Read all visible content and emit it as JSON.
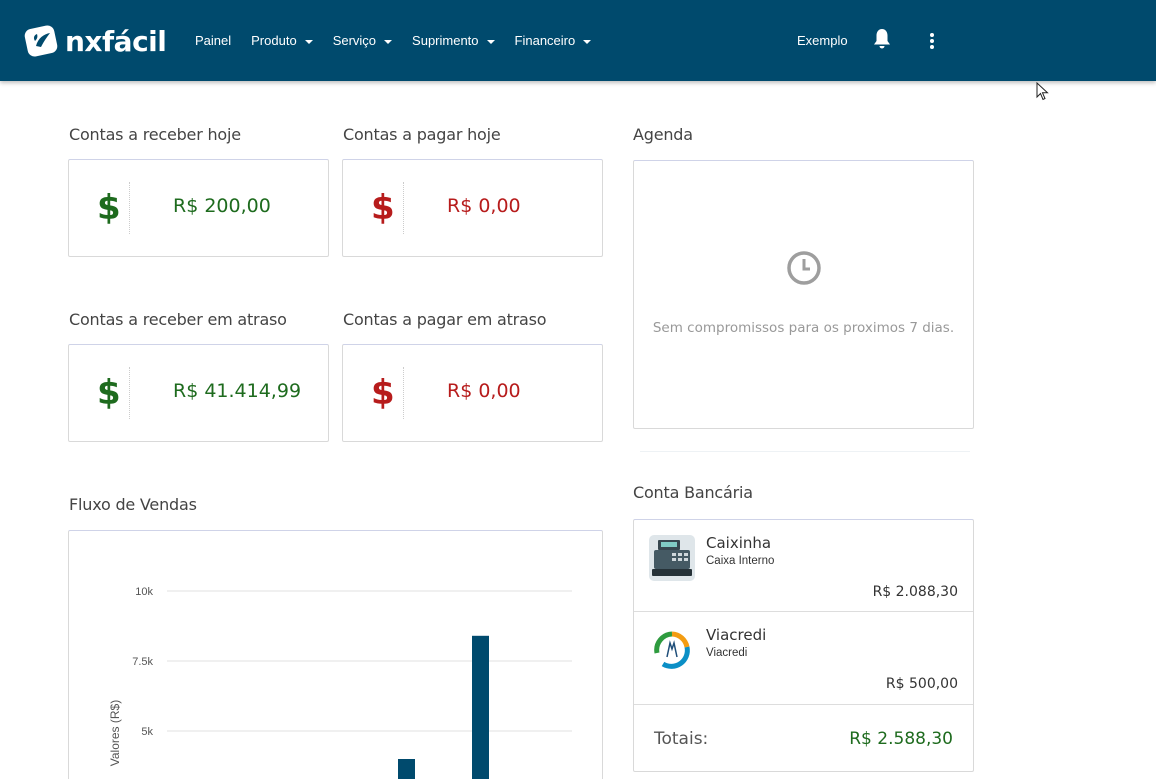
{
  "nav": {
    "brand": "nxfácil",
    "items": [
      {
        "label": "Painel",
        "dropdown": false
      },
      {
        "label": "Produto",
        "dropdown": true
      },
      {
        "label": "Serviço",
        "dropdown": true
      },
      {
        "label": "Suprimento",
        "dropdown": true
      },
      {
        "label": "Financeiro",
        "dropdown": true
      }
    ],
    "user": "Exemplo",
    "icons": [
      "bell-icon",
      "more-vert-icon"
    ]
  },
  "kpis": {
    "receber_hoje": {
      "title": "Contas a receber hoje",
      "sign": "$",
      "value": "R$ 200,00"
    },
    "pagar_hoje": {
      "title": "Contas a pagar hoje",
      "sign": "$",
      "value": "R$ 0,00"
    },
    "receber_atraso": {
      "title": "Contas a receber em atraso",
      "sign": "$",
      "value": "R$ 41.414,99"
    },
    "pagar_atraso": {
      "title": "Contas a pagar em atraso",
      "sign": "$",
      "value": "R$ 0,00"
    }
  },
  "agenda": {
    "title": "Agenda",
    "empty_text": "Sem compromissos para os proximos 7 dias.",
    "icon": "clock-icon"
  },
  "bank": {
    "title": "Conta Bancária",
    "accounts": [
      {
        "name": "Caixinha",
        "subtitle": "Caixa Interno",
        "balance": "R$ 2.088,30",
        "icon": "cash-register-icon"
      },
      {
        "name": "Viacredi",
        "subtitle": "Viacredi",
        "balance": "R$ 500,00",
        "icon": "viacredi-logo-icon"
      }
    ],
    "totals_label": "Totais:",
    "totals_value": "R$ 2.588,30"
  },
  "colors": {
    "navbar": "#004a6d",
    "positive": "#1e6b1e",
    "negative": "#b71c1c",
    "bar": "#004a6d"
  },
  "chart_data": {
    "type": "bar",
    "title": "Fluxo de Vendas",
    "ylabel": "Valores (R$)",
    "y_ticks": [
      "10k",
      "7.5k",
      "5k"
    ],
    "ylim": [
      0,
      10000
    ],
    "values": [
      4000,
      8400
    ],
    "grid": true
  }
}
